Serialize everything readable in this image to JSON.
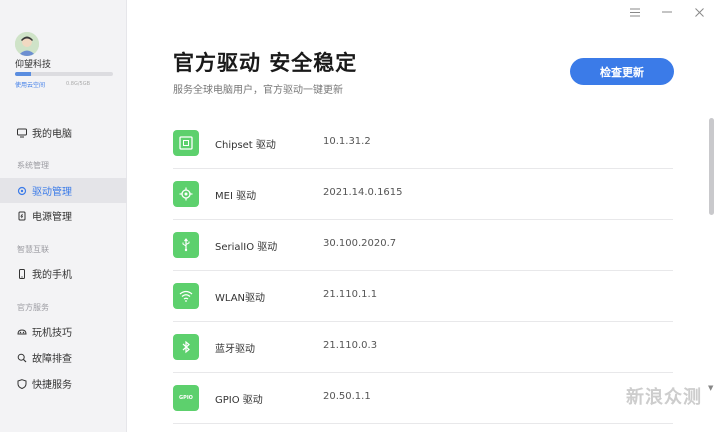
{
  "sidebar": {
    "username": "仰望科技",
    "storage_link": "使用云空间",
    "storage_size": "0.8G/5GB",
    "storage_used": 0.16,
    "items": [
      {
        "label": "我的电脑",
        "icon": "computer-icon"
      },
      {
        "section": "系统管理"
      },
      {
        "label": "驱动管理",
        "icon": "settings-icon",
        "active": true
      },
      {
        "label": "电源管理",
        "icon": "power-icon"
      },
      {
        "section": "智慧互联"
      },
      {
        "label": "我的手机",
        "icon": "phone-icon"
      },
      {
        "section": "官方服务"
      },
      {
        "label": "玩机技巧",
        "icon": "tips-icon"
      },
      {
        "label": "故障排查",
        "icon": "search-icon"
      },
      {
        "label": "快捷服务",
        "icon": "shield-icon"
      }
    ]
  },
  "main": {
    "title": "官方驱动 安全稳定",
    "subtitle": "服务全球电脑用户，官方驱动一键更新",
    "check_button": "检查更新",
    "drivers": [
      {
        "name": "Chipset 驱动",
        "version": "10.1.31.2",
        "icon": "chip-icon"
      },
      {
        "name": "MEI 驱动",
        "version": "2021.14.0.1615",
        "icon": "settings-gear-icon"
      },
      {
        "name": "SerialIO 驱动",
        "version": "30.100.2020.7",
        "icon": "usb-icon"
      },
      {
        "name": "WLAN驱动",
        "version": "21.110.1.1",
        "icon": "wifi-icon"
      },
      {
        "name": "蓝牙驱动",
        "version": "21.110.0.3",
        "icon": "bluetooth-icon"
      },
      {
        "name": "GPIO 驱动",
        "version": "20.50.1.1",
        "icon": "gpio-icon",
        "icon_text": "GPIO"
      }
    ]
  },
  "watermark": "新浪众测",
  "colors": {
    "accent": "#3b7be8",
    "driver_icon_bg": "#5dd06d",
    "sidebar_bg": "#f3f3f5"
  }
}
